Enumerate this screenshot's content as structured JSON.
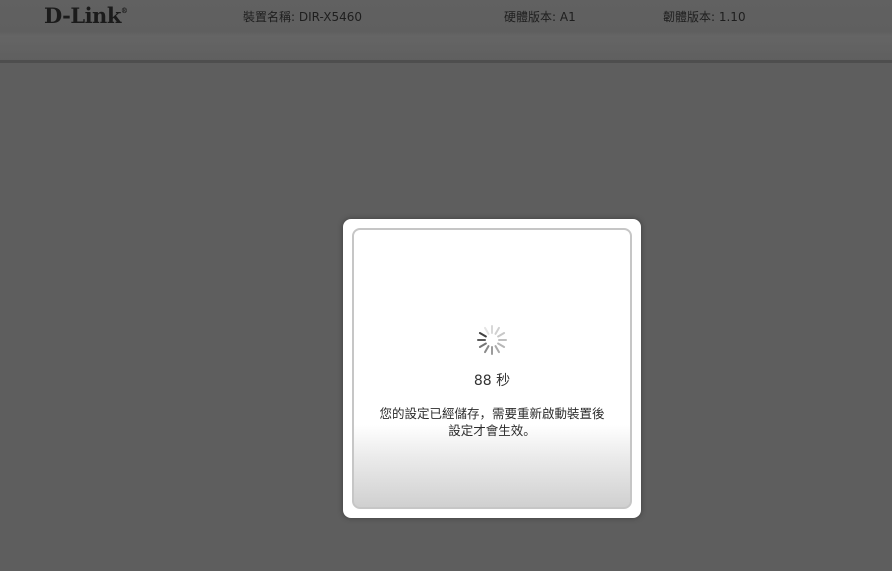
{
  "header": {
    "logo": "D-Link",
    "logo_tm": "®",
    "device_name_label": "裝置名稱: ",
    "device_name_value": "DIR-X5460",
    "hardware_version_label": "硬體版本: ",
    "hardware_version_value": "A1",
    "firmware_version_label": "韌體版本: ",
    "firmware_version_value": "1.10"
  },
  "dialog": {
    "spinner_icon": "loading-spinner-icon",
    "countdown_value": "88",
    "countdown_unit": "秒",
    "message_line1": "您的設定已經儲存，需要重新啟動裝置後",
    "message_line2": "設定才會生效。"
  },
  "colors": {
    "overlay": "#5e5e5e",
    "dialog_bg": "#ffffff",
    "dialog_border": "#c6c6c6"
  }
}
